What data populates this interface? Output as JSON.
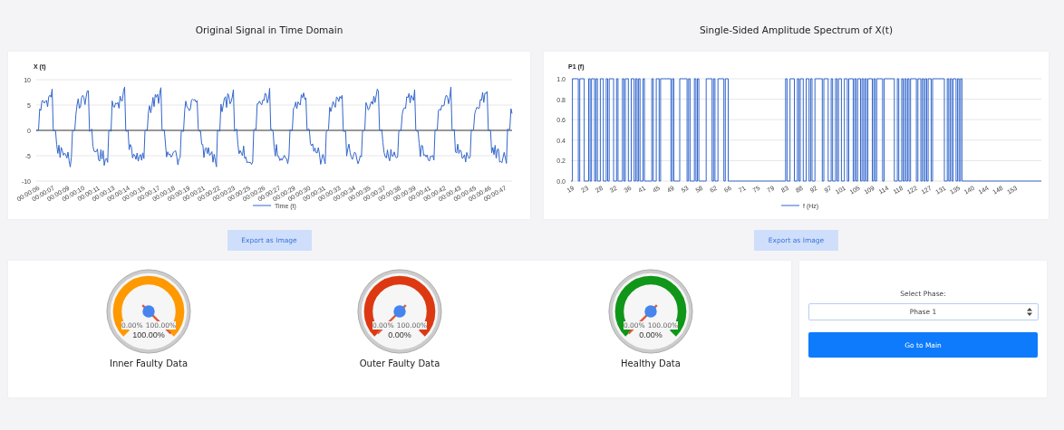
{
  "time_chart": {
    "title": "Original Signal in Time Domain",
    "y_axis_title": "X (t)",
    "yticks": [
      "10",
      "5",
      "0",
      "-5",
      "-10"
    ],
    "xticks": [
      "00:00:06",
      "00:00:07",
      "00:00:09",
      "00:00:10",
      "00:00:11",
      "00:00:13",
      "00:00:14",
      "00:00:15",
      "00:00:17",
      "00:00:18",
      "00:00:19",
      "00:00:21",
      "00:00:22",
      "00:00:23",
      "00:00:25",
      "00:00:26",
      "00:00:27",
      "00:00:29",
      "00:00:30",
      "00:00:31",
      "00:00:33",
      "00:00:34",
      "00:00:35",
      "00:00:37",
      "00:00:38",
      "00:00:39",
      "00:00:41",
      "00:00:42",
      "00:00:43",
      "00:00:45",
      "00:00:46",
      "00:00:47"
    ],
    "legend": "Time (t)",
    "export_button": "Export as Image"
  },
  "spectrum_chart": {
    "title": "Single-Sided Amplitude Spectrum of X(t)",
    "y_axis_title": "P1 (f)",
    "yticks": [
      "1.0",
      "0.8",
      "0.6",
      "0.4",
      "0.2",
      "0.0"
    ],
    "xticks": [
      "19",
      "23",
      "28",
      "32",
      "36",
      "41",
      "45",
      "49",
      "53",
      "58",
      "62",
      "66",
      "71",
      "75",
      "79",
      "83",
      "88",
      "92",
      "97",
      "101",
      "105",
      "109",
      "114",
      "118",
      "122",
      "127",
      "131",
      "135",
      "140",
      "144",
      "148",
      "153"
    ],
    "legend": "f (Hz)",
    "export_button": "Export as Image"
  },
  "gauges": [
    {
      "label": "Inner Faulty Data",
      "reading": "100.00%",
      "min": "0.00%",
      "max": "100.00%",
      "color": "#ff9900"
    },
    {
      "label": "Outer Faulty Data",
      "reading": "0.00%",
      "min": "0.00%",
      "max": "100.00%",
      "color": "#dc3912"
    },
    {
      "label": "Healthy Data",
      "reading": "0.00%",
      "min": "0.00%",
      "max": "100.00%",
      "color": "#109618"
    }
  ],
  "phase_panel": {
    "label": "Select Phase:",
    "value": "Phase 1",
    "button": "Go to Main"
  }
}
